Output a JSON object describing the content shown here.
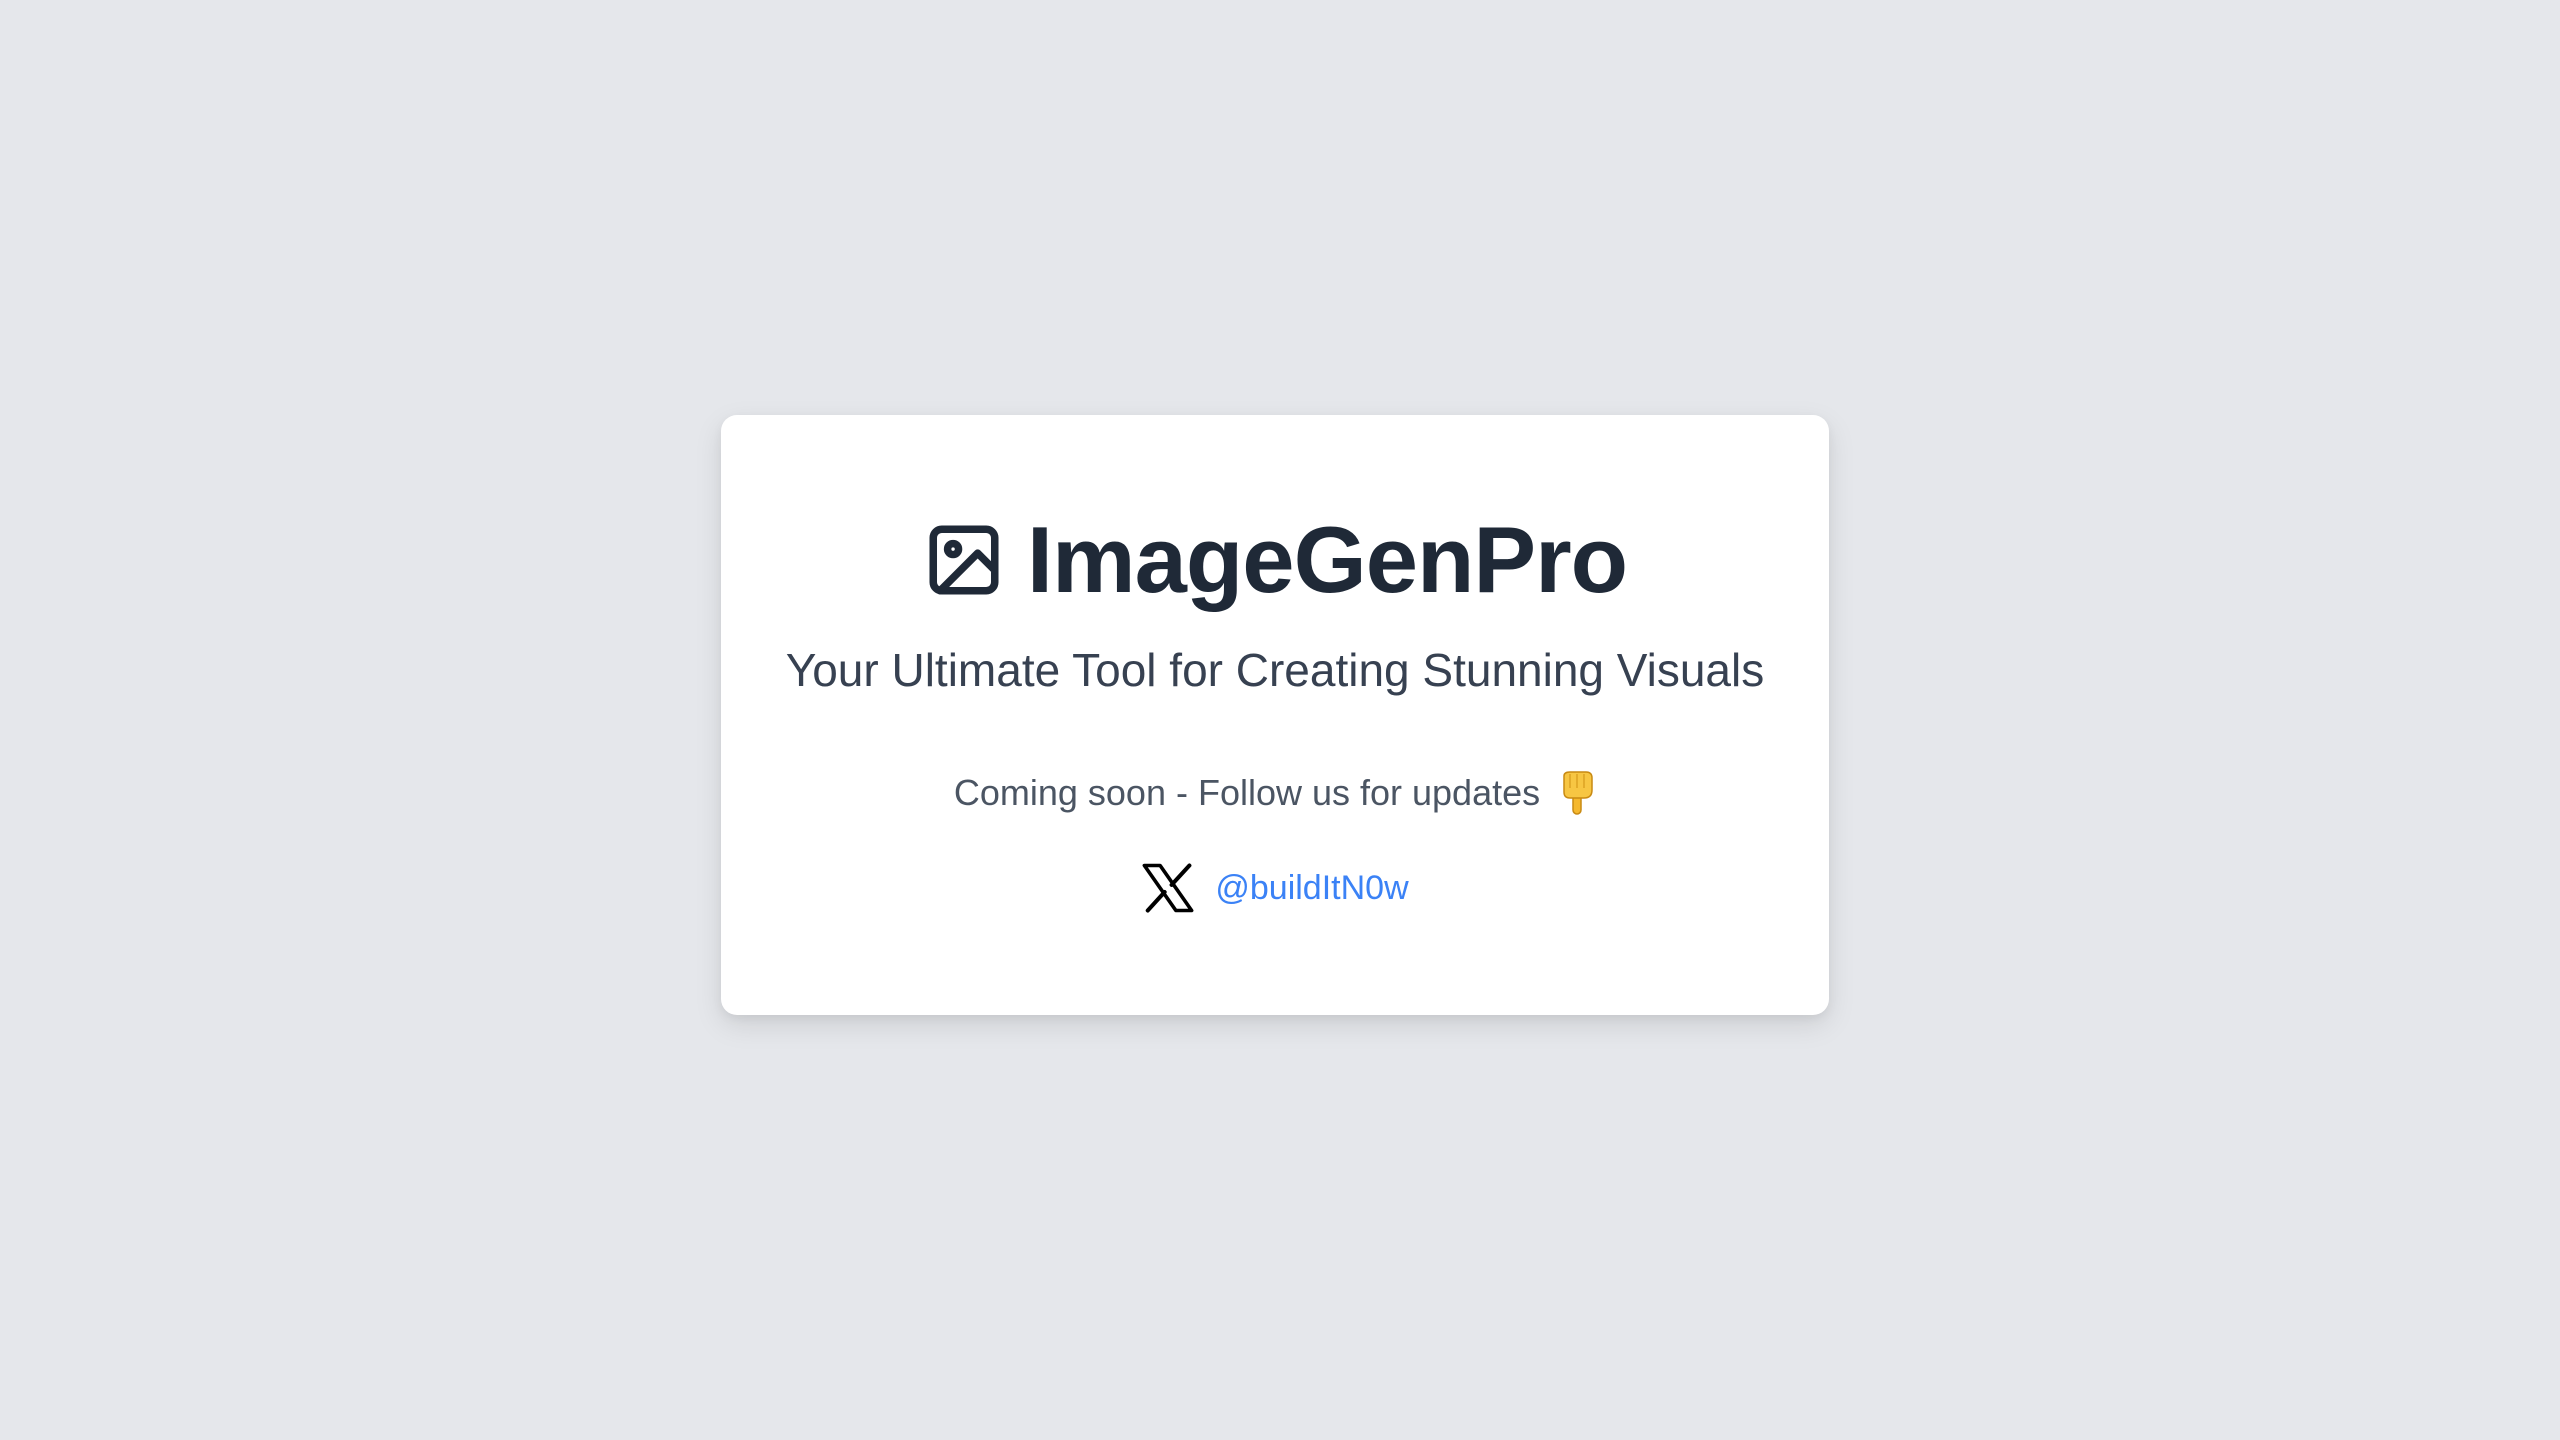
{
  "brand": {
    "title": "ImageGenPro",
    "subtitle": "Your Ultimate Tool for Creating Stunning Visuals",
    "logo_icon": "image-icon"
  },
  "announcement": {
    "text": "Coming soon - Follow us for updates",
    "emoji_icon": "pointing-down-hand-icon"
  },
  "social": {
    "icon": "x-logo-icon",
    "handle": "@buildItN0w",
    "link_color": "#3b82f6"
  },
  "colors": {
    "background": "#e5e7eb",
    "card": "#ffffff",
    "title": "#1f2937",
    "subtitle": "#374151",
    "body": "#4b5563"
  }
}
